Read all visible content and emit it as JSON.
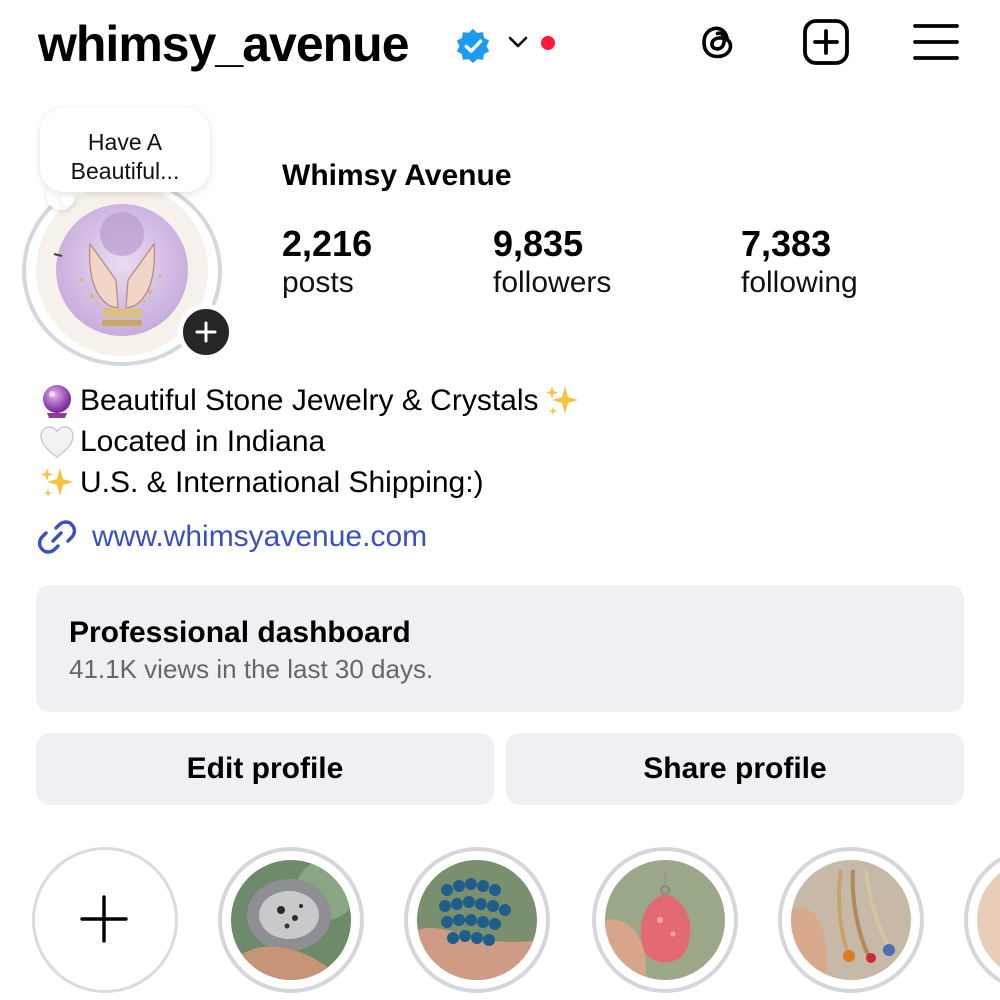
{
  "header": {
    "username": "whimsy_avenue",
    "verified_icon": "verified-badge-icon",
    "accent_color": "#1d9bf0",
    "notification_color": "#ff1a3b"
  },
  "profile": {
    "note": "Have A Beautiful...",
    "display_name": "Whimsy Avenue",
    "stats": [
      {
        "value": "2,216",
        "label": "posts"
      },
      {
        "value": "9,835",
        "label": "followers"
      },
      {
        "value": "7,383",
        "label": "following"
      }
    ],
    "bio": [
      {
        "emoji": "crystal-ball-icon",
        "text": "Beautiful Stone Jewelry & Crystals",
        "trailing_emoji": "sparkles-icon"
      },
      {
        "emoji": "white-heart-icon",
        "text": "Located in Indiana"
      },
      {
        "emoji": "sparkles-icon",
        "text": "U.S. & International Shipping:)"
      }
    ],
    "link": "www.whimsyavenue.com",
    "link_color": "#3b4fc4"
  },
  "dashboard": {
    "title": "Professional dashboard",
    "subtitle": "41.1K views in the last 30 days."
  },
  "buttons": {
    "edit": "Edit profile",
    "share": "Share profile"
  },
  "highlights": [
    {
      "kind": "new",
      "icon": "plus-icon"
    },
    {
      "kind": "image",
      "subject": "geode crystal"
    },
    {
      "kind": "image",
      "subject": "blue bead bracelets"
    },
    {
      "kind": "image",
      "subject": "pink stone pendant"
    },
    {
      "kind": "image",
      "subject": "beaded necklaces"
    },
    {
      "kind": "image",
      "subject": "partial highlight"
    }
  ]
}
